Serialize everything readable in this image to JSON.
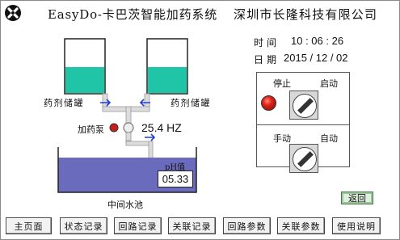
{
  "header": {
    "app_title": "EasyDo-卡巴茨智能加药系统",
    "company": "深圳市长隆科技有限公司",
    "logo_icon": "x-circle-logo-icon"
  },
  "status": {
    "time_label": "时间",
    "time_value": "10 : 06 : 26",
    "date_label": "日期",
    "date_value": "2015 / 12 / 02"
  },
  "process": {
    "tank_left_label": "药剂储罐",
    "tank_right_label": "药剂储罐",
    "tank_level_left": 0.48,
    "tank_level_right": 0.48,
    "pump_label": "加药泵",
    "pump_frequency": "25.4 HZ",
    "ph_label": "pH值",
    "ph_value": "05.33",
    "pool_label": "中间水池",
    "liquid_color": "#20c5a8",
    "water_color": "#6b6bbd",
    "arrow_color": "#1f3fd8"
  },
  "control_panel": {
    "stop_label": "停止",
    "start_label": "启动",
    "manual_label": "手动",
    "auto_label": "自动",
    "lamp_icon": "red-indicator-lamp-icon"
  },
  "back_button": "返回",
  "nav": {
    "items": [
      "主页面",
      "状态记录",
      "回路记录",
      "关联记录",
      "回路参数",
      "关联参数",
      "使用说明"
    ]
  }
}
